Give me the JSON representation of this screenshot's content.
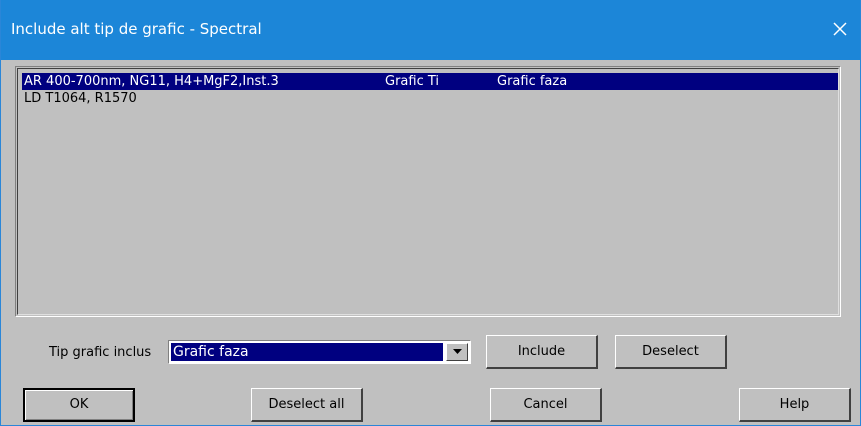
{
  "window": {
    "title": "Include alt tip de grafic - Spectral"
  },
  "list": {
    "rows": [
      {
        "col1": "AR 400-700nm, NG11, H4+MgF2,Inst.3",
        "col2": "Grafic Ti",
        "col3": "Grafic faza",
        "selected": true
      },
      {
        "col1": "LD T1064, R1570",
        "col2": "",
        "col3": "",
        "selected": false
      }
    ]
  },
  "controls": {
    "tip_label": "Tip grafic inclus",
    "tip_value": "Grafic faza",
    "include_label": "Include",
    "deselect_label": "Deselect"
  },
  "buttons": {
    "ok": "OK",
    "deselect_all": "Deselect all",
    "cancel": "Cancel",
    "help": "Help"
  },
  "colors": {
    "titlebar": "#1c86d8",
    "selection": "#000080",
    "face": "#c0c0c0"
  }
}
